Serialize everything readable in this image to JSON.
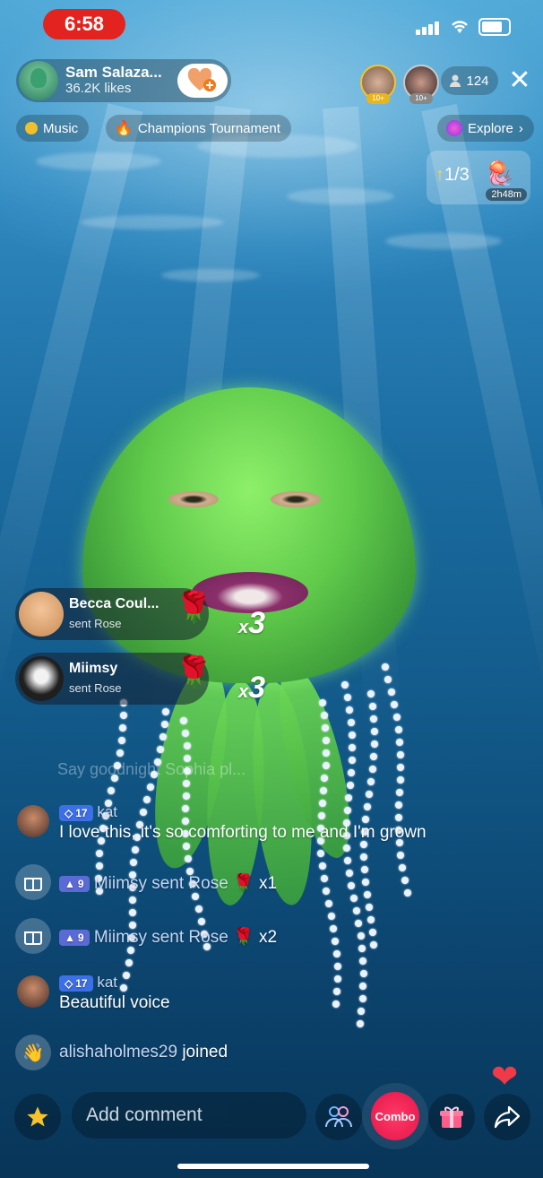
{
  "status": {
    "time": "6:58"
  },
  "host": {
    "name": "Sam Salaza...",
    "likes": "36.2K likes"
  },
  "viewers": {
    "top1_tag": "10+",
    "top2_tag": "10+",
    "count": "124"
  },
  "chips": {
    "music": "Music",
    "tournament": "Champions Tournament",
    "explore": "Explore"
  },
  "ranking": {
    "value": "1/3",
    "timer": "2h48m"
  },
  "gifts": [
    {
      "name": "Becca Coul...",
      "action": "sent Rose",
      "multiplier": "3",
      "x": "x"
    },
    {
      "name": "Miimsy",
      "action": "sent Rose",
      "multiplier": "3",
      "x": "x"
    }
  ],
  "chat": {
    "faded_line": "Say goodnight Sophia pl...",
    "messages": [
      {
        "level": "17",
        "user": "kat",
        "text": "I love this, it's so comforting to me and I'm grown"
      },
      {
        "level": "9",
        "text": "Miimsy sent Rose",
        "count": "x1"
      },
      {
        "level": "9",
        "text": "Miimsy sent Rose",
        "count": "x2"
      },
      {
        "level": "17",
        "user": "kat",
        "text": "Beautiful voice"
      }
    ],
    "joined": {
      "user": "alishaholmes29",
      "action": "joined"
    }
  },
  "bottom": {
    "comment_placeholder": "Add comment",
    "combo_label": "Combo"
  }
}
